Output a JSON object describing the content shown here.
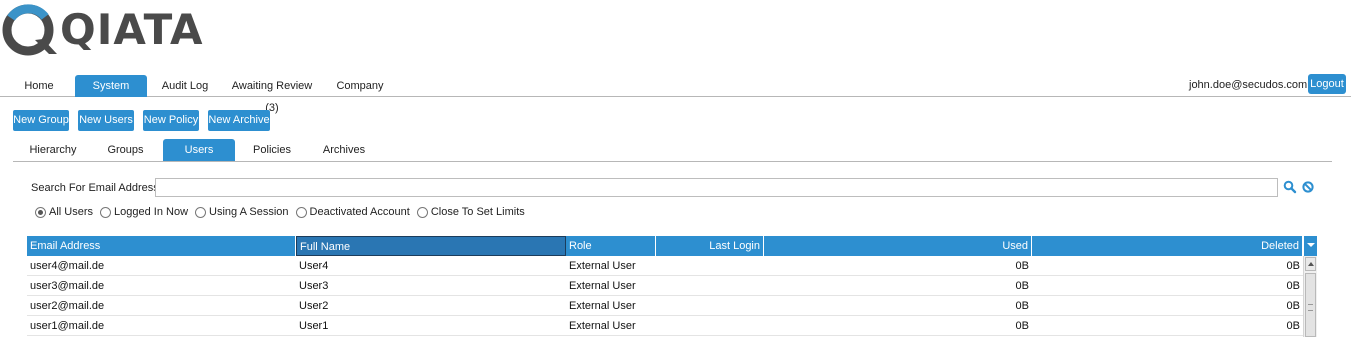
{
  "brand": {
    "name": "QIATA",
    "accent": "#2d8fd0",
    "logo_accent": "#3b93c8",
    "logo_dark": "#4a4a4a"
  },
  "main_nav": {
    "tabs": [
      {
        "label": "Home",
        "active": false
      },
      {
        "label": "System",
        "active": true
      },
      {
        "label": "Audit Log",
        "active": false
      },
      {
        "label": "Awaiting Review (3)",
        "active": false
      },
      {
        "label": "Company",
        "active": false
      }
    ],
    "user_email": "john.doe@secudos.com",
    "logout_label": "Logout"
  },
  "actions": {
    "new_group": "New Group",
    "new_users": "New Users",
    "new_policy": "New Policy",
    "new_archive": "New Archive"
  },
  "sub_nav": {
    "tabs": [
      {
        "label": "Hierarchy",
        "active": false
      },
      {
        "label": "Groups",
        "active": false
      },
      {
        "label": "Users",
        "active": true
      },
      {
        "label": "Policies",
        "active": false
      },
      {
        "label": "Archives",
        "active": false
      }
    ]
  },
  "search": {
    "label": "Search For Email Address :",
    "value": "",
    "search_icon": "magnifier-icon",
    "clear_icon": "cancel-icon"
  },
  "filters": {
    "selected": "All Users",
    "options": [
      "All Users",
      "Logged In Now",
      "Using A Session",
      "Deactivated Account",
      "Close To Set Limits"
    ]
  },
  "table": {
    "columns": [
      "Email Address",
      "Full Name",
      "Role",
      "Last Login",
      "Used",
      "Deleted"
    ],
    "sorted_column": "Full Name",
    "rows": [
      {
        "email": "user4@mail.de",
        "full_name": "User4",
        "role": "External User",
        "last_login": "",
        "used": "0B",
        "deleted": "0B"
      },
      {
        "email": "user3@mail.de",
        "full_name": "User3",
        "role": "External User",
        "last_login": "",
        "used": "0B",
        "deleted": "0B"
      },
      {
        "email": "user2@mail.de",
        "full_name": "User2",
        "role": "External User",
        "last_login": "",
        "used": "0B",
        "deleted": "0B"
      },
      {
        "email": "user1@mail.de",
        "full_name": "User1",
        "role": "External User",
        "last_login": "",
        "used": "0B",
        "deleted": "0B"
      }
    ]
  }
}
